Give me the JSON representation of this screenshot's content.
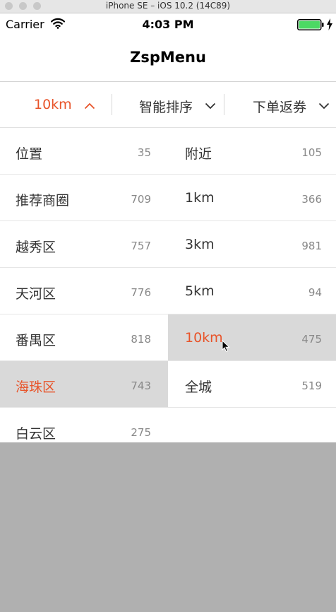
{
  "window": {
    "title": "iPhone SE – iOS 10.2 (14C89)"
  },
  "status_bar": {
    "carrier": "Carrier",
    "time": "4:03 PM"
  },
  "nav": {
    "title": "ZspMenu"
  },
  "menu": {
    "tabs": [
      {
        "label": "10km",
        "active": true
      },
      {
        "label": "智能排序",
        "active": false
      },
      {
        "label": "下单返券",
        "active": false
      }
    ]
  },
  "left_list": [
    {
      "name": "位置",
      "count": "35"
    },
    {
      "name": "推荐商圈",
      "count": "709"
    },
    {
      "name": "越秀区",
      "count": "757"
    },
    {
      "name": "天河区",
      "count": "776"
    },
    {
      "name": "番禺区",
      "count": "818"
    },
    {
      "name": "海珠区",
      "count": "743",
      "selected": true
    },
    {
      "name": "白云区",
      "count": "275"
    }
  ],
  "right_list": [
    {
      "name": "附近",
      "count": "105"
    },
    {
      "name": "1km",
      "count": "366"
    },
    {
      "name": "3km",
      "count": "981"
    },
    {
      "name": "5km",
      "count": "94"
    },
    {
      "name": "10km",
      "count": "475",
      "selected": true
    },
    {
      "name": "全城",
      "count": "519"
    }
  ],
  "colors": {
    "accent": "#e8542a",
    "selected_bg": "#d9d9d9",
    "overlay": "#b0b0b0"
  },
  "icons": [
    "wifi-icon",
    "battery-icon",
    "charge-icon",
    "chevron-up-icon",
    "chevron-down-icon",
    "cursor-icon"
  ]
}
